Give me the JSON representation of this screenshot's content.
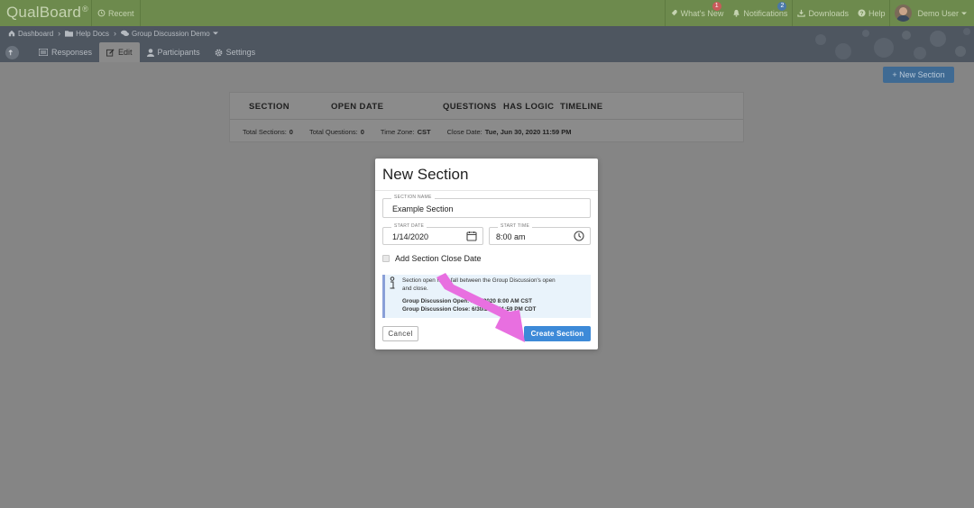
{
  "brand": {
    "name": "QualBoard",
    "mark": "®"
  },
  "topbar": {
    "recent_label": "Recent",
    "whats_new_label": "What's New",
    "whats_new_badge": "1",
    "notifications_label": "Notifications",
    "notifications_badge": "2",
    "downloads_label": "Downloads",
    "help_label": "Help",
    "user_label": "Demo User"
  },
  "breadcrumb": {
    "items": [
      "Dashboard",
      "Help Docs",
      "Group Discussion Demo"
    ]
  },
  "tabs": {
    "responses": "Responses",
    "edit": "Edit",
    "participants": "Participants",
    "settings": "Settings"
  },
  "page": {
    "new_section_button": "+ New Section",
    "table": {
      "headers": [
        "SECTION",
        "OPEN DATE",
        "QUESTIONS",
        "HAS LOGIC",
        "TIMELINE"
      ],
      "stats": {
        "total_sections_label": "Total Sections:",
        "total_sections_value": "0",
        "total_questions_label": "Total Questions:",
        "total_questions_value": "0",
        "time_zone_label": "Time Zone:",
        "time_zone_value": "CST",
        "close_date_label": "Close Date:",
        "close_date_value": "Tue, Jun 30, 2020 11:59 PM"
      }
    }
  },
  "modal": {
    "title": "New Section",
    "section_name_label": "SECTION NAME",
    "section_name_value": "Example Section",
    "start_date_label": "START DATE",
    "start_date_value": "1/14/2020",
    "start_time_label": "START TIME",
    "start_time_value": "8:00 am",
    "close_date_checkbox_label": "Add Section Close Date",
    "info_line1": "Section open must fall between the Group Discussion's open",
    "info_line2": "and close.",
    "info_open": "Group Discussion Open: 1/14/2020 8:00 AM CST",
    "info_close": "Group Discussion Close: 6/30/2020 11:59 PM CDT",
    "cancel_label": "Cancel",
    "create_label": "Create Section"
  },
  "colors": {
    "topbar": "#6d8a4d",
    "subbar": "#4e5660",
    "overlay_bg": "#858585",
    "primary_button": "#3d8ad8",
    "annotation_arrow": "#e86fe0"
  }
}
